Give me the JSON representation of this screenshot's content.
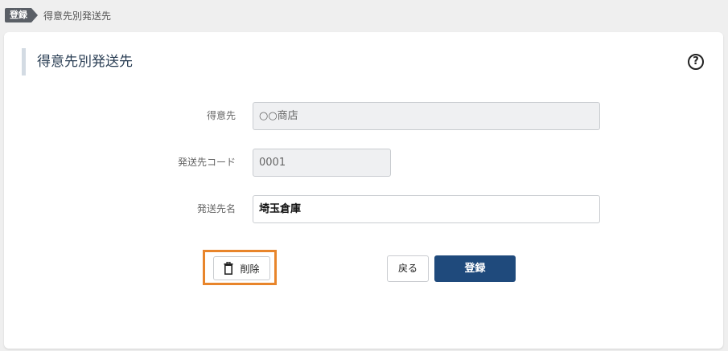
{
  "breadcrumb": {
    "badge": "登録",
    "current": "得意先別発送先"
  },
  "card": {
    "title": "得意先別発送先",
    "help_icon": "?"
  },
  "form": {
    "customer": {
      "label": "得意先",
      "value": "○○商店"
    },
    "ship_code": {
      "label": "発送先コード",
      "value": "0001"
    },
    "ship_name": {
      "label": "発送先名",
      "value": "埼玉倉庫"
    }
  },
  "actions": {
    "delete_label": "削除",
    "back_label": "戻る",
    "register_label": "登録"
  },
  "colors": {
    "primary": "#1f4a7c",
    "highlight": "#e8852b",
    "badge": "#5a5f66"
  }
}
